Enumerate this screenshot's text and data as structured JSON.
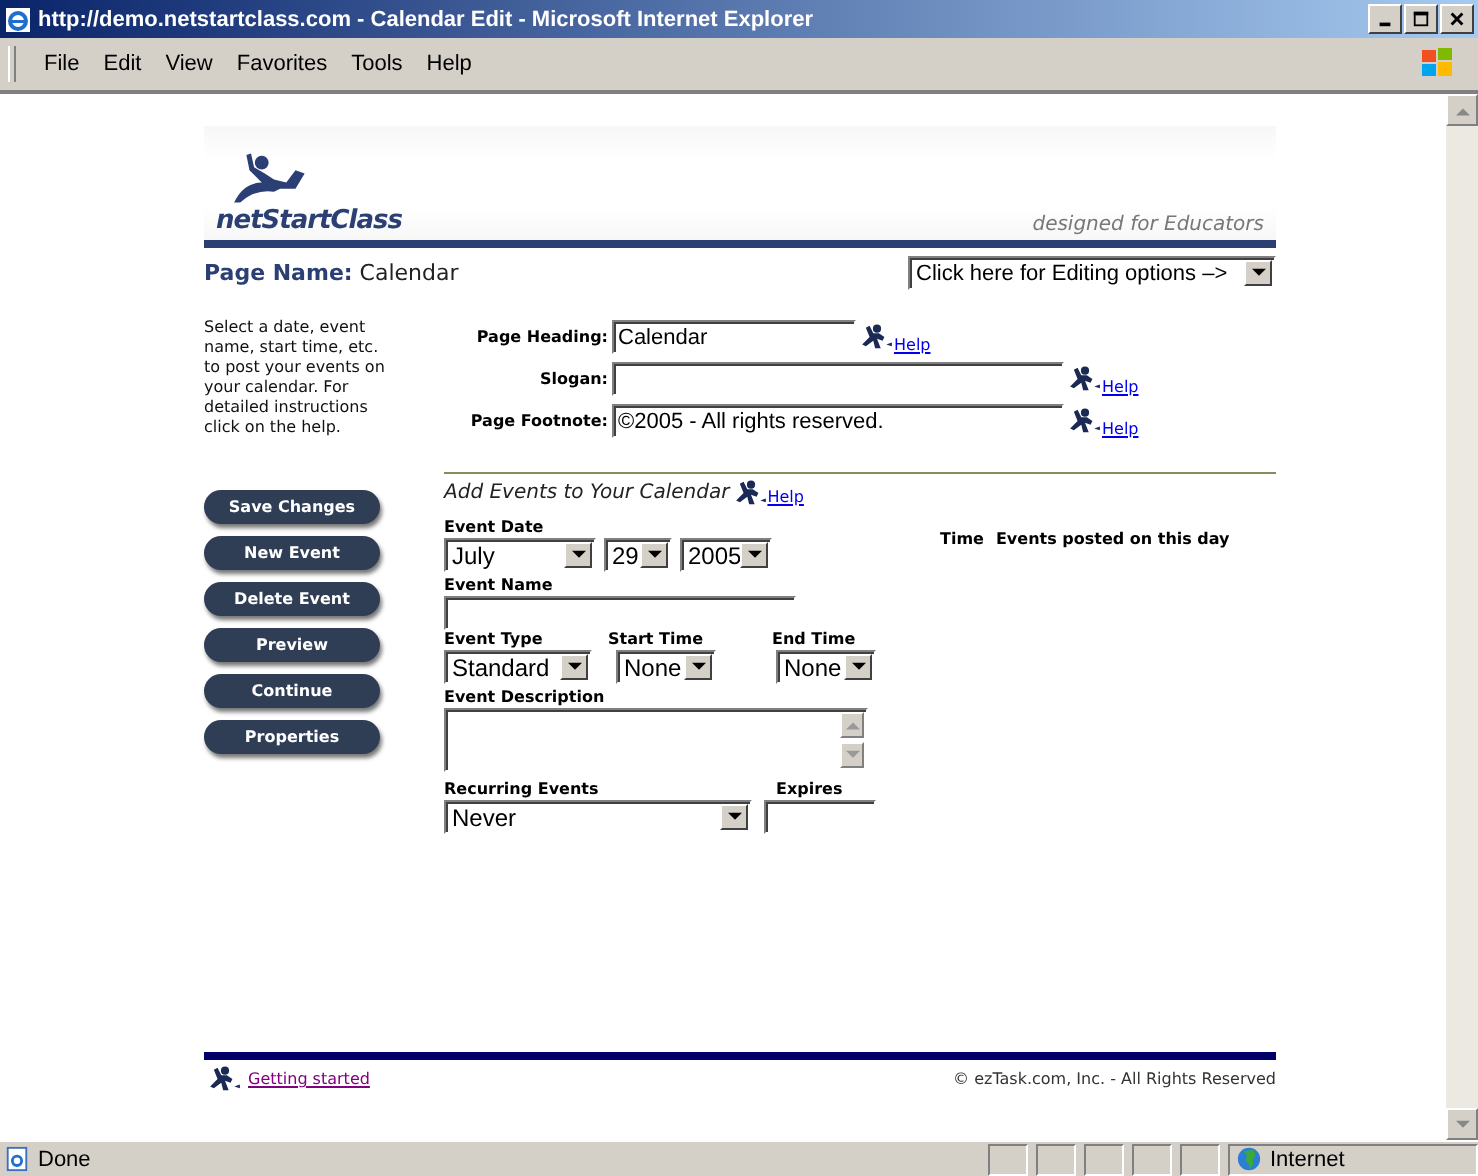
{
  "window": {
    "title": "http://demo.netstartclass.com - Calendar Edit - Microsoft Internet Explorer",
    "menu": [
      "File",
      "Edit",
      "View",
      "Favorites",
      "Tools",
      "Help"
    ]
  },
  "header": {
    "logo_text": "netStartClass",
    "tagline": "designed for Educators"
  },
  "page_name": {
    "label": "Page Name:",
    "value": "Calendar"
  },
  "editing_options": {
    "value": "Click here for Editing options –>"
  },
  "instructions": "Select a date, event name, start time, etc. to post your events on your calendar.  For detailed instructions click on the help.",
  "page_fields": [
    {
      "label": "Page Heading:",
      "value": "Calendar",
      "help": "Help"
    },
    {
      "label": "Slogan:",
      "help": "Help"
    },
    {
      "label": "Page Footnote:",
      "value": "©2005 - All rights reserved.",
      "help": "Help"
    }
  ],
  "events_section": {
    "title": "Add Events to Your Calendar",
    "help": "Help"
  },
  "buttons": [
    "Save Changes",
    "New Event",
    "Delete Event",
    "Preview",
    "Continue",
    "Properties"
  ],
  "event_form": {
    "date_label": "Event Date",
    "month": "July",
    "day": "29",
    "year": "2005",
    "name_label": "Event Name",
    "type_label": "Event Type",
    "type": "Standard",
    "start_label": "Start Time",
    "start": "None",
    "end_label": "End Time",
    "end": "None",
    "description_label": "Event Description",
    "recurring_label": "Recurring Events",
    "recurring": "Never",
    "expires_label": "Expires"
  },
  "events_list": {
    "time_header": "Time",
    "events_header": "Events posted on this day"
  },
  "footer": {
    "link": "Getting started",
    "copyright": "© ezTask.com, Inc. - All Rights Reserved"
  },
  "status_bar": {
    "status": "Done",
    "zone": "Internet"
  }
}
